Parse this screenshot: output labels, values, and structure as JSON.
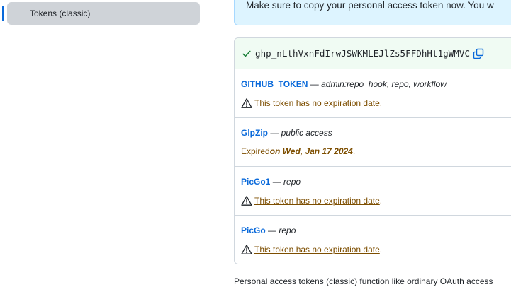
{
  "sidebar": {
    "active_item": {
      "label": "Tokens (classic)"
    }
  },
  "flash": {
    "message": "Make sure to copy your personal access token now. You w"
  },
  "new_token": {
    "value": "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",
    "status": "created",
    "check_icon": "check-icon",
    "copy_icon": "copy-icon"
  },
  "tokens": [
    {
      "name": "GITHUB_TOKEN",
      "separator": " — ",
      "scopes": "admin:repo_hook, repo, workflow",
      "status_type": "no-expiration",
      "status_text": "This token has no expiration date",
      "status_suffix": "."
    },
    {
      "name": "GlpZip",
      "separator": " — ",
      "scopes": "public access",
      "status_type": "expired",
      "expired_prefix": "Expired",
      "expired_date": " on Wed, Jan 17 2024",
      "status_suffix": "."
    },
    {
      "name": "PicGo1",
      "separator": " — ",
      "scopes": "repo",
      "status_type": "no-expiration",
      "status_text": "This token has no expiration date",
      "status_suffix": "."
    },
    {
      "name": "PicGo",
      "separator": " — ",
      "scopes": "repo",
      "status_type": "no-expiration",
      "status_text": "This token has no expiration date",
      "status_suffix": "."
    }
  ],
  "footer": {
    "text": "Personal access tokens (classic) function like ordinary OAuth access"
  },
  "colors": {
    "link": "#0969da",
    "warning": "#7d4e00",
    "success": "#1a7f37",
    "sidebar_active_bg": "#cfd3d8",
    "flash_bg": "#ddf4ff",
    "new_token_bg": "#f0fbf3"
  }
}
